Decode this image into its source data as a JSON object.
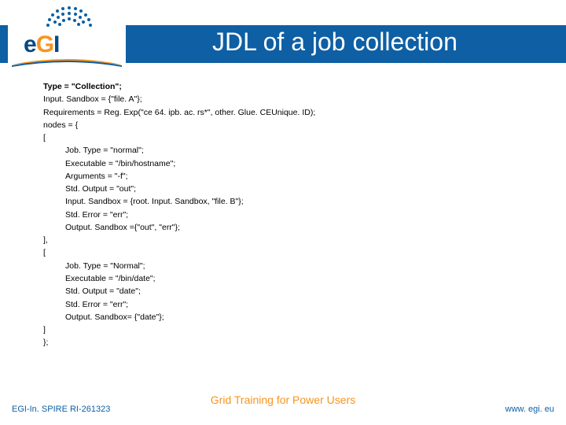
{
  "header": {
    "title": "JDL of a job collection",
    "logo_text_left": "e",
    "logo_text_mid": "G",
    "logo_text_right": "I"
  },
  "code": {
    "l00": "Type = \"Collection\";",
    "l01": "Input. Sandbox = {\"file. A\"};",
    "l02": "Requirements = Reg. Exp(\"ce 64. ipb. ac. rs*\", other. Glue. CEUnique. ID);",
    "l03": "nodes = {",
    "l04": "[",
    "l05": "Job. Type = \"normal\";",
    "l06": "Executable = \"/bin/hostname\";",
    "l07": "Arguments = \"-f\";",
    "l08": "Std. Output = \"out\";",
    "l09": "Input. Sandbox = {root. Input. Sandbox, \"file. B\"};",
    "l10": "Std. Error = \"err\";",
    "l11": "Output. Sandbox ={\"out\", \"err\"};",
    "l12": "],",
    "l13": "[",
    "l14": "Job. Type = \"Normal\";",
    "l15": "Executable = \"/bin/date\";",
    "l16": "Std. Output = \"date\";",
    "l17": "Std. Error = \"err\";",
    "l18": "Output. Sandbox= {\"date\"};",
    "l19": "]",
    "l20": "};"
  },
  "footer": {
    "left": "EGI-In. SPIRE RI-261323",
    "center": "Grid Training for Power Users",
    "right": "www. egi. eu"
  }
}
